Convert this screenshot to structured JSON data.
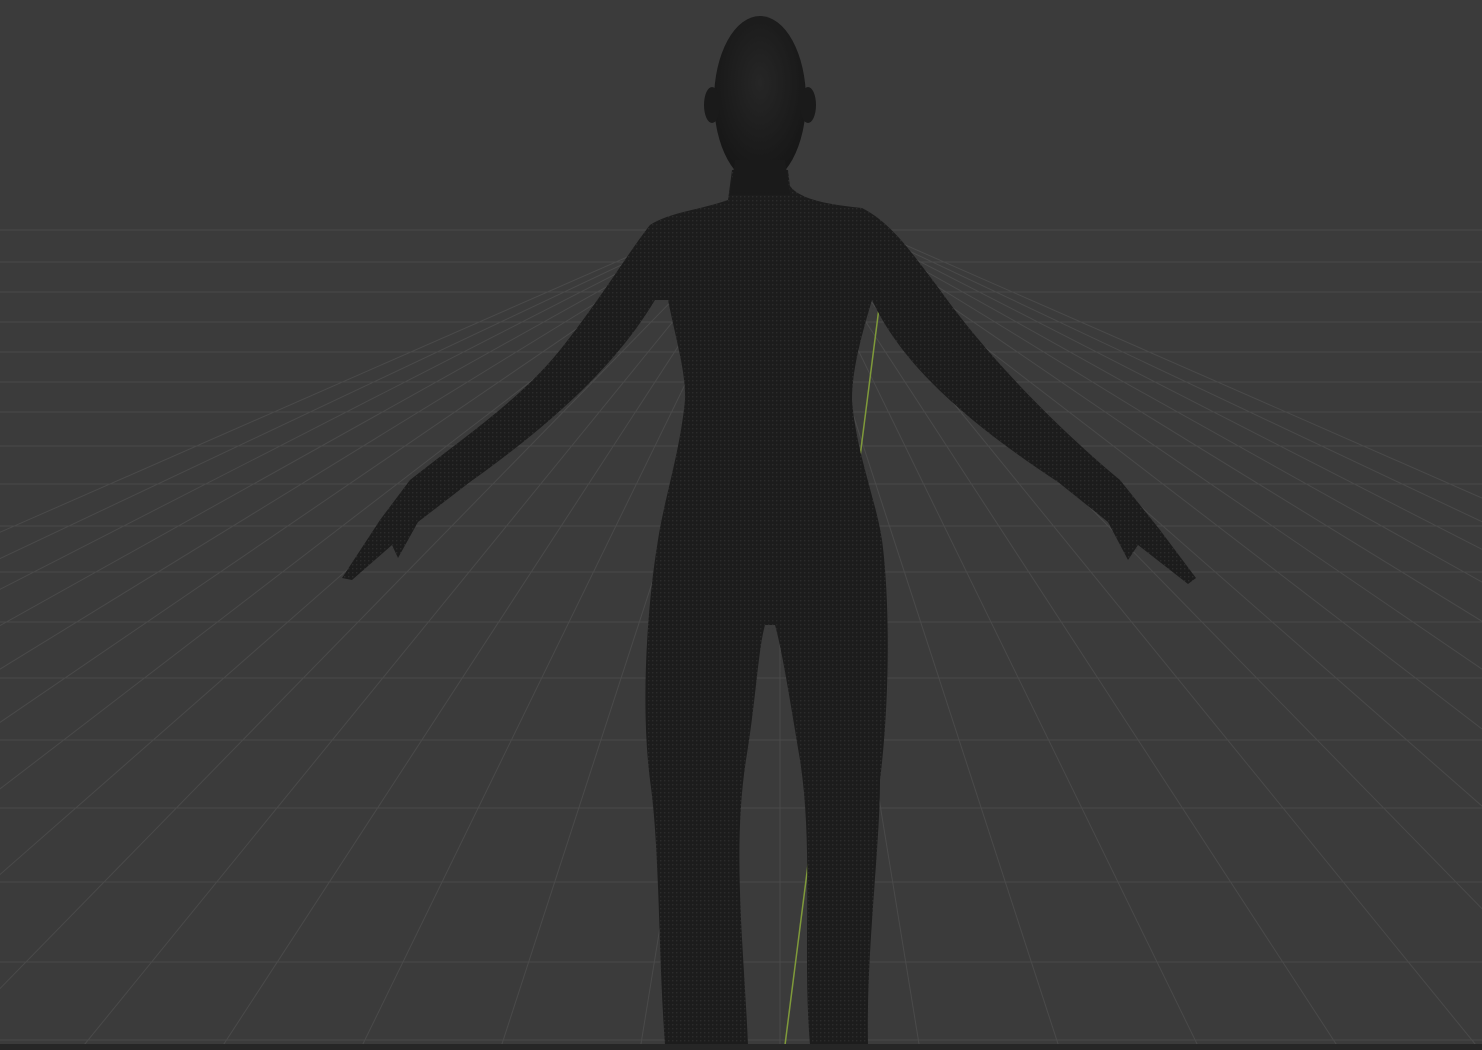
{
  "viewport": {
    "mode": "3d-viewport",
    "object": "human-body-mesh",
    "colors": {
      "background": "#3b3b3b",
      "grid": "#4a4a4a",
      "y_axis": "#7f9a3a",
      "mesh": "#1c1c1c",
      "mesh_dots": "#2a2a2a"
    }
  }
}
